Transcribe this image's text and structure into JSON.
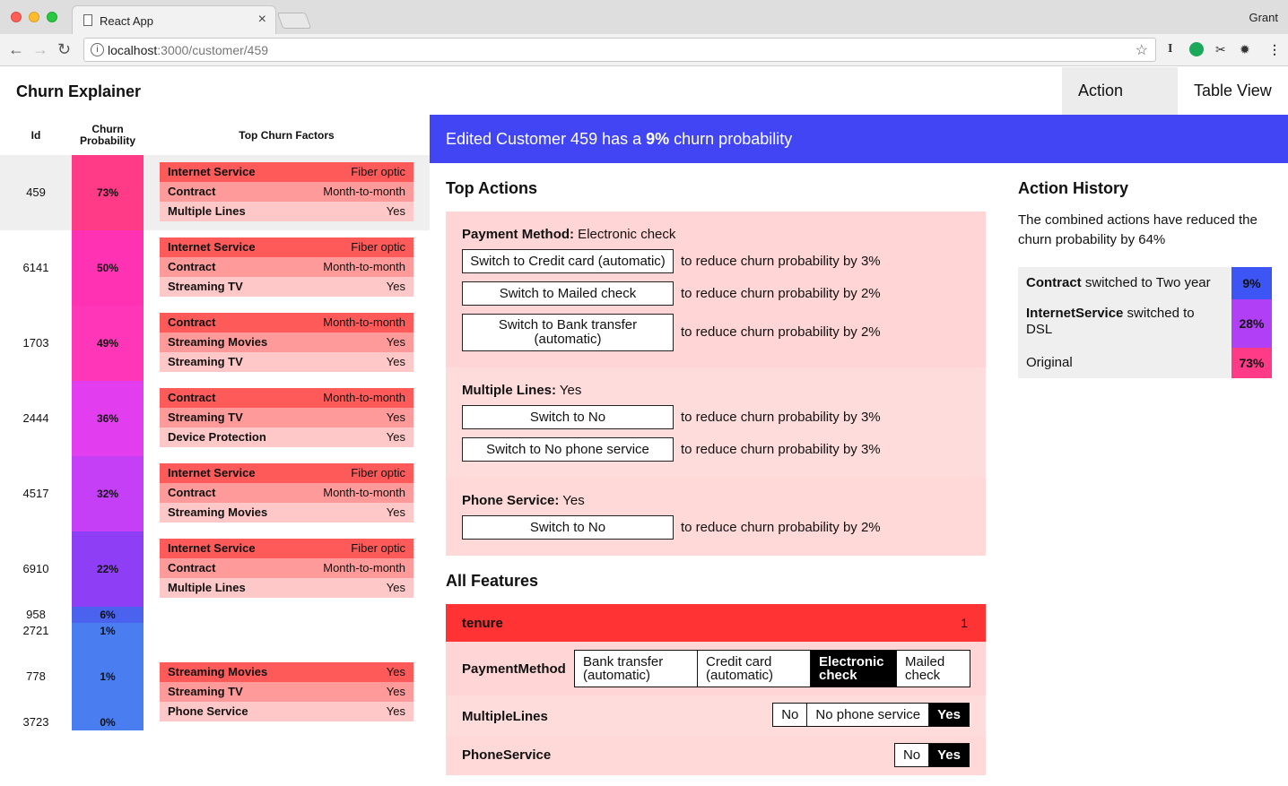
{
  "browser": {
    "tab_title": "React App",
    "tab_close": "×",
    "profile_name": "Grant",
    "url_host": "localhost",
    "url_path": ":3000/customer/459",
    "ext_1": "I"
  },
  "app": {
    "title": "Churn Explainer",
    "nav": {
      "action_view": "Action View",
      "table_view": "Table View"
    }
  },
  "list": {
    "headers": {
      "id": "Id",
      "prob": "Churn Probability",
      "factors": "Top Churn Factors"
    },
    "rows": [
      {
        "id": "459",
        "prob": "73%",
        "color": "#ff3a86",
        "factors": [
          {
            "name": "Internet Service",
            "value": "Fiber optic"
          },
          {
            "name": "Contract",
            "value": "Month-to-month"
          },
          {
            "name": "Multiple Lines",
            "value": "Yes"
          }
        ]
      },
      {
        "id": "6141",
        "prob": "50%",
        "color": "#ff32b4",
        "factors": [
          {
            "name": "Internet Service",
            "value": "Fiber optic"
          },
          {
            "name": "Contract",
            "value": "Month-to-month"
          },
          {
            "name": "Streaming TV",
            "value": "Yes"
          }
        ]
      },
      {
        "id": "1703",
        "prob": "49%",
        "color": "#ff36b8",
        "factors": [
          {
            "name": "Contract",
            "value": "Month-to-month"
          },
          {
            "name": "Streaming Movies",
            "value": "Yes"
          },
          {
            "name": "Streaming TV",
            "value": "Yes"
          }
        ]
      },
      {
        "id": "2444",
        "prob": "36%",
        "color": "#e33df0",
        "factors": [
          {
            "name": "Contract",
            "value": "Month-to-month"
          },
          {
            "name": "Streaming TV",
            "value": "Yes"
          },
          {
            "name": "Device Protection",
            "value": "Yes"
          }
        ]
      },
      {
        "id": "4517",
        "prob": "32%",
        "color": "#c53ff6",
        "factors": [
          {
            "name": "Internet Service",
            "value": "Fiber optic"
          },
          {
            "name": "Contract",
            "value": "Month-to-month"
          },
          {
            "name": "Streaming Movies",
            "value": "Yes"
          }
        ]
      },
      {
        "id": "6910",
        "prob": "22%",
        "color": "#8e3ff5",
        "factors": [
          {
            "name": "Internet Service",
            "value": "Fiber optic"
          },
          {
            "name": "Contract",
            "value": "Month-to-month"
          },
          {
            "name": "Multiple Lines",
            "value": "Yes"
          }
        ]
      },
      {
        "id": "958",
        "prob": "6%",
        "color": "#4a62ee",
        "factors": []
      },
      {
        "id": "2721",
        "prob": "1%",
        "color": "#4a7df0",
        "factors": []
      },
      {
        "id": "778",
        "prob": "1%",
        "color": "#4a7df0",
        "factors": [
          {
            "name": "Streaming Movies",
            "value": "Yes"
          },
          {
            "name": "Streaming TV",
            "value": "Yes"
          },
          {
            "name": "Phone Service",
            "value": "Yes"
          }
        ]
      },
      {
        "id": "3723",
        "prob": "0%",
        "color": "#4a7df0",
        "factors": []
      }
    ]
  },
  "banner": {
    "prefix": "Edited Customer 459 has a ",
    "value": "9%",
    "suffix": " churn probability"
  },
  "top_actions": {
    "title": "Top Actions",
    "groups": [
      {
        "feature": "Payment Method:",
        "current": "Electronic check",
        "actions": [
          {
            "label": "Switch to Credit card (automatic)",
            "effect": "to reduce churn probability by 3%"
          },
          {
            "label": "Switch to Mailed check",
            "effect": "to reduce churn probability by 2%"
          },
          {
            "label": "Switch to Bank transfer (automatic)",
            "effect": "to reduce churn probability by 2%"
          }
        ]
      },
      {
        "feature": "Multiple Lines:",
        "current": "Yes",
        "actions": [
          {
            "label": "Switch to No",
            "effect": "to reduce churn probability by 3%"
          },
          {
            "label": "Switch to No phone service",
            "effect": "to reduce churn probability by 3%"
          }
        ]
      },
      {
        "feature": "Phone Service:",
        "current": "Yes",
        "actions": [
          {
            "label": "Switch to No",
            "effect": "to reduce churn probability by 2%"
          }
        ]
      }
    ]
  },
  "all_features": {
    "title": "All Features",
    "tenure": {
      "label": "tenure",
      "value": "1"
    },
    "payment": {
      "label": "PaymentMethod",
      "options": [
        "Bank transfer (automatic)",
        "Credit card (automatic)",
        "Electronic check",
        "Mailed check"
      ],
      "selected": "Electronic check"
    },
    "multiple_lines": {
      "label": "MultipleLines",
      "options": [
        "No",
        "No phone service",
        "Yes"
      ],
      "selected": "Yes"
    },
    "phone_service": {
      "label": "PhoneService",
      "options": [
        "No",
        "Yes"
      ],
      "selected": "Yes"
    }
  },
  "history": {
    "title": "Action History",
    "description": "The combined actions have reduced the churn probability by 64%",
    "items": [
      {
        "feature": "Contract",
        "text": " switched to Two year",
        "value": "9%",
        "color": "#3d55f5"
      },
      {
        "feature": "InternetService",
        "text": " switched to DSL",
        "value": "28%",
        "color": "#b03ff6"
      },
      {
        "feature": "",
        "text": "Original",
        "value": "73%",
        "color": "#ff3a86"
      }
    ]
  },
  "colors": {
    "banner": "#4145f3",
    "factor_strong": "#ff5a5a",
    "factor_mid": "#ff9a9a",
    "factor_light": "#ffc8c8",
    "action_box": "#ffd5d5",
    "tenure_bar": "#ff3333"
  }
}
